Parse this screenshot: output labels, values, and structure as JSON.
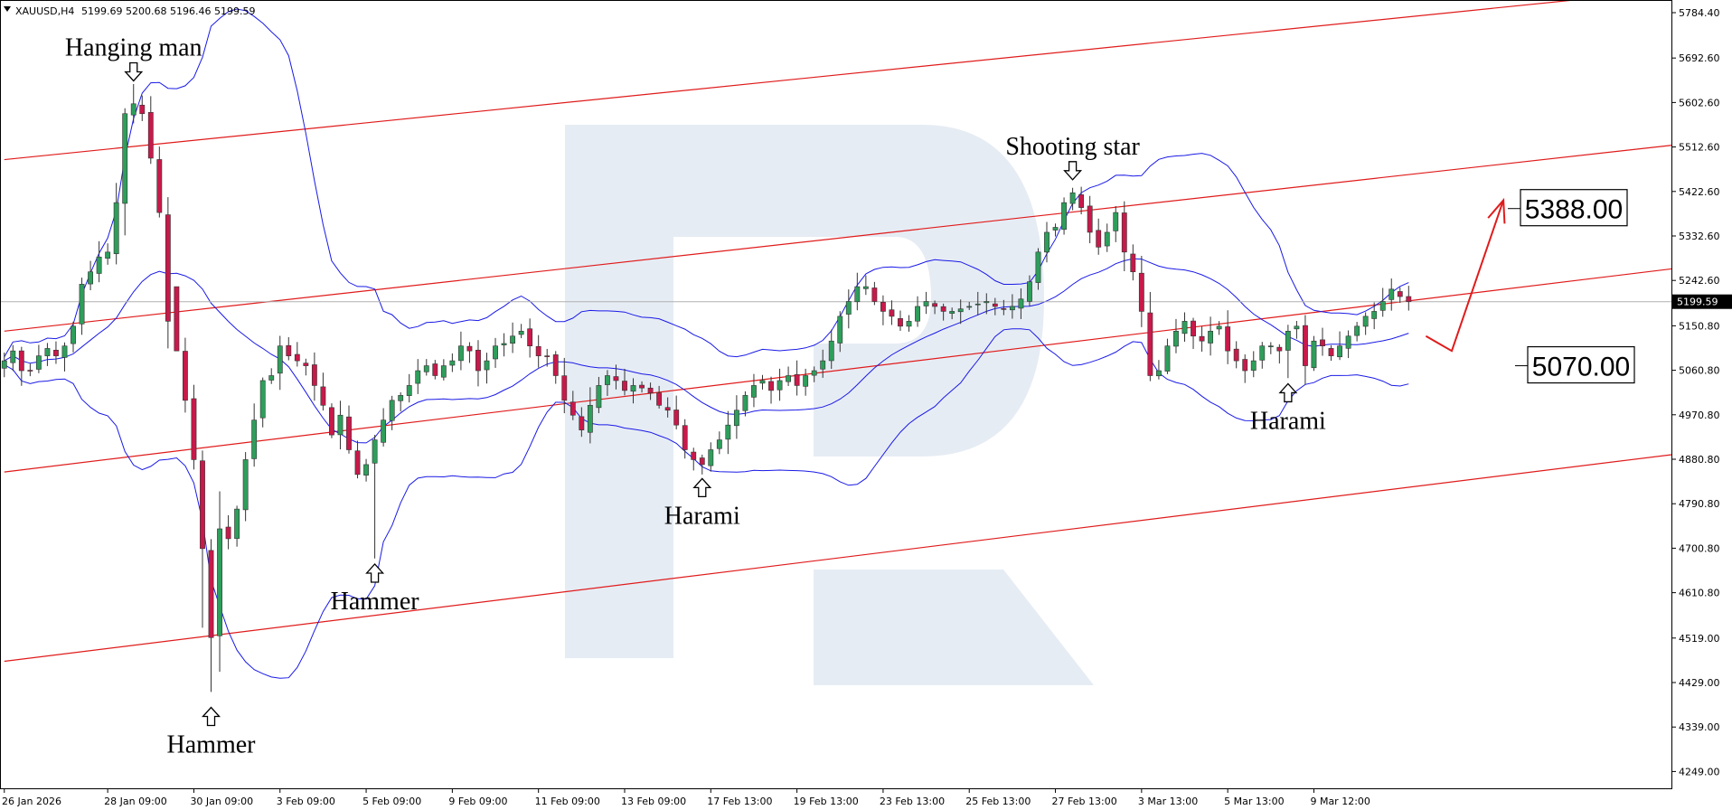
{
  "symbol_header": {
    "symbol": "XAUUSD,H4",
    "ohlc": "5199.69 5200.68 5196.46 5199.59"
  },
  "current_price": "5199.59",
  "colors": {
    "bull": "#2e9e5b",
    "bear": "#c8194a",
    "bollinger": "#1a1ae6",
    "channel": "#e01b1b",
    "arrow": "#e01b1b",
    "price_line": "#b0b0b0",
    "watermark": "#e6ecf4"
  },
  "chart_data": {
    "type": "candlestick",
    "title": "XAUUSD,H4",
    "y_ticks": [
      5784.4,
      5692.6,
      5602.6,
      5512.6,
      5422.6,
      5332.6,
      5242.6,
      5150.8,
      5060.8,
      4970.8,
      4880.8,
      4790.8,
      4700.8,
      4610.8,
      4519.0,
      4429.0,
      4339.0,
      4249.0
    ],
    "y_tick_labels": [
      "5784.40",
      "5692.60",
      "5602.60",
      "5512.60",
      "5422.60",
      "5332.60",
      "5242.60",
      "5150.80",
      "5060.80",
      "4970.80",
      "4880.80",
      "4790.80",
      "4700.80",
      "4610.80",
      "4519.00",
      "4429.00",
      "4339.00",
      "4249.00"
    ],
    "x_labels": [
      "26 Jan 2026",
      "28 Jan 09:00",
      "30 Jan 09:00",
      "3 Feb 09:00",
      "5 Feb 09:00",
      "9 Feb 09:00",
      "11 Feb 09:00",
      "13 Feb 09:00",
      "17 Feb 13:00",
      "19 Feb 13:00",
      "23 Feb 13:00",
      "25 Feb 13:00",
      "27 Feb 13:00",
      "3 Mar 13:00",
      "5 Mar 13:00",
      "9 Mar 12:00"
    ],
    "x_label_bars": [
      0,
      12,
      22,
      32,
      42,
      52,
      62,
      72,
      82,
      92,
      102,
      112,
      122,
      132,
      142,
      152
    ],
    "ylim": [
      4215,
      5810
    ],
    "xlim": [
      -0.5,
      193.5
    ],
    "close": [
      5080,
      5100,
      5060,
      5060,
      5090,
      5105,
      5090,
      5110,
      5150,
      5235,
      5260,
      5290,
      5300,
      5400,
      5580,
      5600,
      5580,
      5490,
      5380,
      5160,
      5100,
      5000,
      4880,
      4700,
      4520,
      4740,
      4720,
      4780,
      4880,
      4960,
      5040,
      5050,
      5110,
      5090,
      5080,
      5070,
      5030,
      4990,
      4930,
      4970,
      4900,
      4850,
      4870,
      4920,
      4960,
      5000,
      5010,
      5030,
      5060,
      5070,
      5050,
      5070,
      5080,
      5110,
      5100,
      5060,
      5080,
      5110,
      5115,
      5130,
      5140,
      5110,
      5090,
      5090,
      5050,
      5000,
      4970,
      4940,
      4990,
      5030,
      5050,
      5040,
      5020,
      5030,
      5025,
      5015,
      4990,
      4980,
      4950,
      4900,
      4880,
      4870,
      4900,
      4920,
      4950,
      4980,
      5010,
      5030,
      5040,
      5020,
      5040,
      5050,
      5030,
      5050,
      5060,
      5080,
      5120,
      5170,
      5200,
      5230,
      5230,
      5200,
      5180,
      5170,
      5150,
      5160,
      5190,
      5200,
      5190,
      5180,
      5180,
      5185,
      5190,
      5195,
      5200,
      5190,
      5185,
      5190,
      5205,
      5240,
      5300,
      5340,
      5350,
      5400,
      5420,
      5390,
      5340,
      5310,
      5340,
      5380,
      5300,
      5260,
      5180,
      5050,
      5060,
      5110,
      5140,
      5160,
      5130,
      5120,
      5140,
      5150,
      5100,
      5080,
      5060,
      5080,
      5110,
      5110,
      5100,
      5140,
      5150,
      5070,
      5120,
      5110,
      5090,
      5110,
      5130,
      5150,
      5170,
      5180,
      5200,
      5225,
      5210,
      5199.59
    ],
    "series": [
      {
        "name": "Hanging man",
        "bar": 15,
        "direction": "down"
      },
      {
        "name": "Hammer",
        "bar": 24,
        "direction": "up"
      },
      {
        "name": "Hammer",
        "bar": 43,
        "direction": "up"
      },
      {
        "name": "Harami",
        "bar": 81,
        "direction": "up"
      },
      {
        "name": "Shooting star",
        "bar": 124,
        "direction": "down"
      },
      {
        "name": "Harami",
        "bar": 149,
        "direction": "up"
      }
    ],
    "annotations": [
      {
        "text": "Hanging man",
        "bar": 15,
        "price": 5650,
        "direction": "down"
      },
      {
        "text": "Hammer",
        "bar": 24,
        "price": 4375,
        "direction": "up"
      },
      {
        "text": "Hammer",
        "bar": 43,
        "price": 4665,
        "direction": "up"
      },
      {
        "text": "Harami",
        "bar": 81,
        "price": 4838,
        "direction": "up"
      },
      {
        "text": "Shooting star",
        "bar": 124,
        "price": 5450,
        "direction": "down"
      },
      {
        "text": "Harami",
        "bar": 149,
        "price": 5030,
        "direction": "up"
      }
    ],
    "levels": [
      {
        "label": "5388.00",
        "price": 5388
      },
      {
        "label": "5070.00",
        "price": 5070
      }
    ],
    "channel_lines": [
      {
        "p1": [
          0,
          5487
        ],
        "p2": [
          193.5,
          5830
        ]
      },
      {
        "p1": [
          0,
          5140
        ],
        "p2": [
          193.5,
          5516
        ]
      },
      {
        "p1": [
          0,
          4855
        ],
        "p2": [
          193.5,
          5266
        ]
      },
      {
        "p1": [
          0,
          4472
        ],
        "p2": [
          193.5,
          4890
        ]
      }
    ],
    "forecast_arrow": [
      [
        165,
        5130
      ],
      [
        168,
        5100
      ],
      [
        174,
        5405
      ]
    ],
    "grid": false
  }
}
